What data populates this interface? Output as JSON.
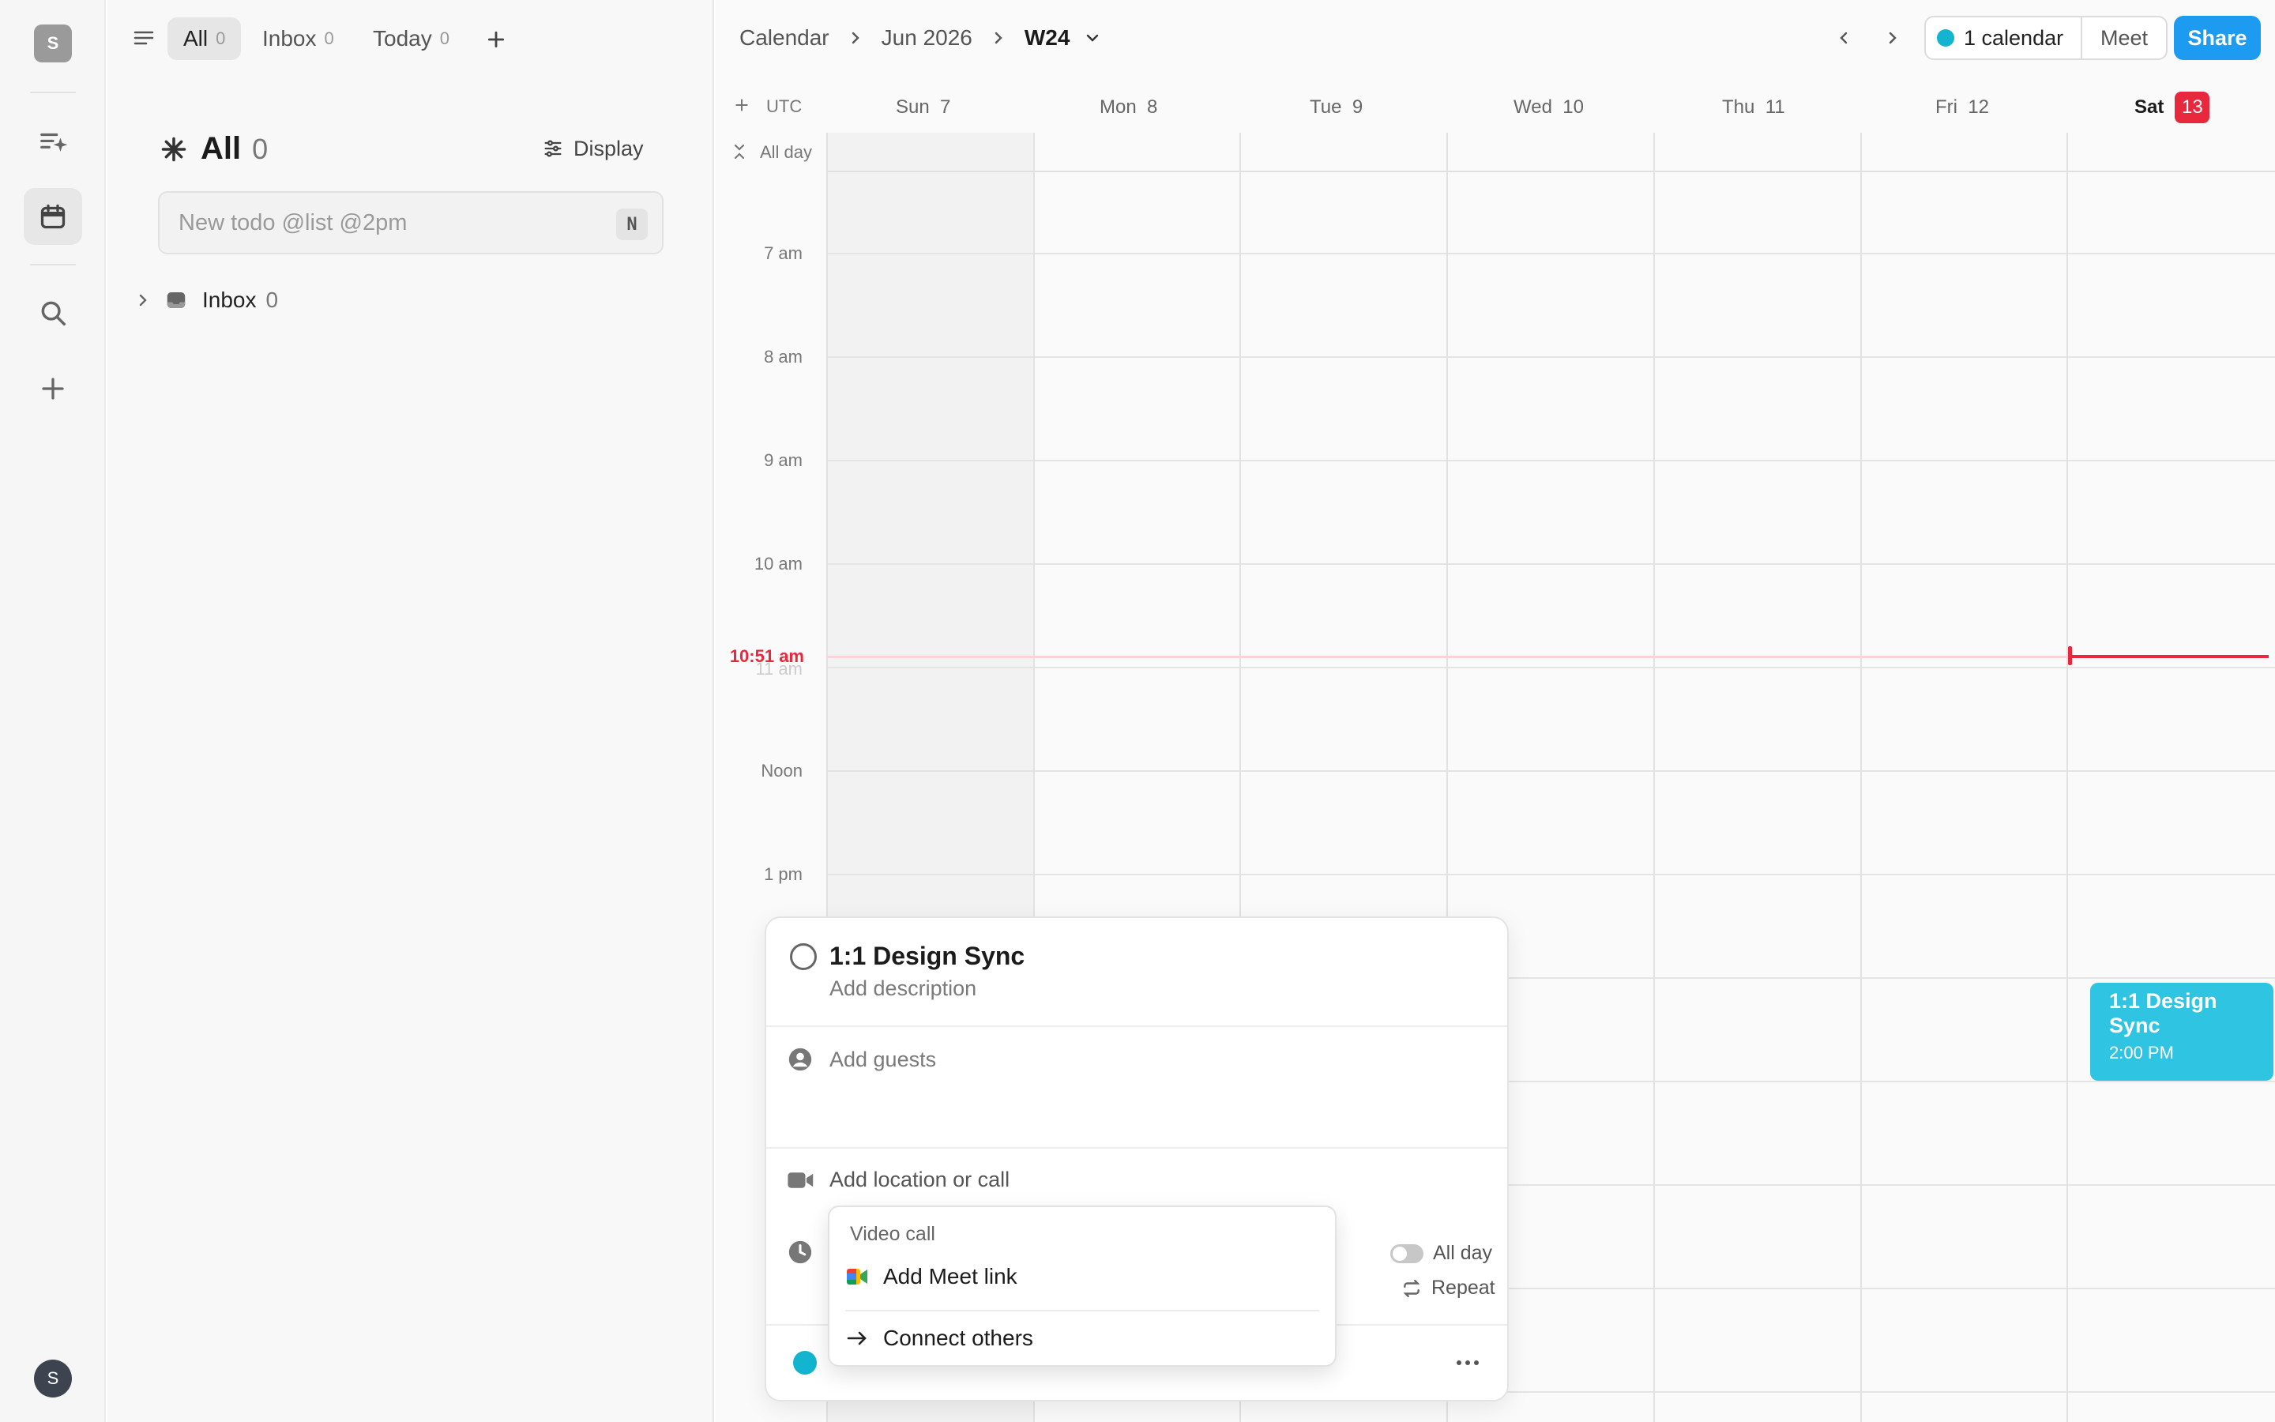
{
  "rail": {
    "workspace_initial": "S",
    "avatar_initial": "S",
    "icons": [
      "tasks-icon",
      "calendar-icon",
      "search-icon",
      "plus-icon"
    ]
  },
  "panel": {
    "tabs": [
      {
        "label": "All",
        "count": "0"
      },
      {
        "label": "Inbox",
        "count": "0"
      },
      {
        "label": "Today",
        "count": "0"
      }
    ],
    "title": "All",
    "title_count": "0",
    "display_label": "Display",
    "new_todo_placeholder": "New todo @list @2pm",
    "new_todo_shortcut": "N",
    "inbox_label": "Inbox",
    "inbox_count": "0"
  },
  "calendar": {
    "breadcrumb": [
      "Calendar",
      "Jun 2026",
      "W24"
    ],
    "calendar_selector": "1 calendar",
    "meet_label": "Meet",
    "share_label": "Share",
    "accent_color": "#12b4cf",
    "timezone": "UTC",
    "allday_label": "All day",
    "days": [
      {
        "name": "Sun",
        "num": "7"
      },
      {
        "name": "Mon",
        "num": "8"
      },
      {
        "name": "Tue",
        "num": "9"
      },
      {
        "name": "Wed",
        "num": "10"
      },
      {
        "name": "Thu",
        "num": "11"
      },
      {
        "name": "Fri",
        "num": "12"
      },
      {
        "name": "Sat",
        "num": "13",
        "today": true
      }
    ],
    "hours": [
      "7 am",
      "8 am",
      "9 am",
      "10 am",
      "11 am",
      "Noon",
      "1 pm"
    ],
    "now_label": "10:51 am",
    "event": {
      "title": "1:1 Design Sync",
      "time": "2:00 PM"
    }
  },
  "editor": {
    "title": "1:1 Design Sync",
    "description_placeholder": "Add description",
    "guests_placeholder": "Add guests",
    "location_placeholder": "Add location or call",
    "allday_label": "All day",
    "repeat_label": "Repeat"
  },
  "dropdown": {
    "header": "Video call",
    "items": [
      {
        "label": "Add Meet link",
        "icon": "google-meet-icon"
      },
      {
        "label": "Connect others",
        "icon": "arrow-right-icon"
      }
    ]
  }
}
